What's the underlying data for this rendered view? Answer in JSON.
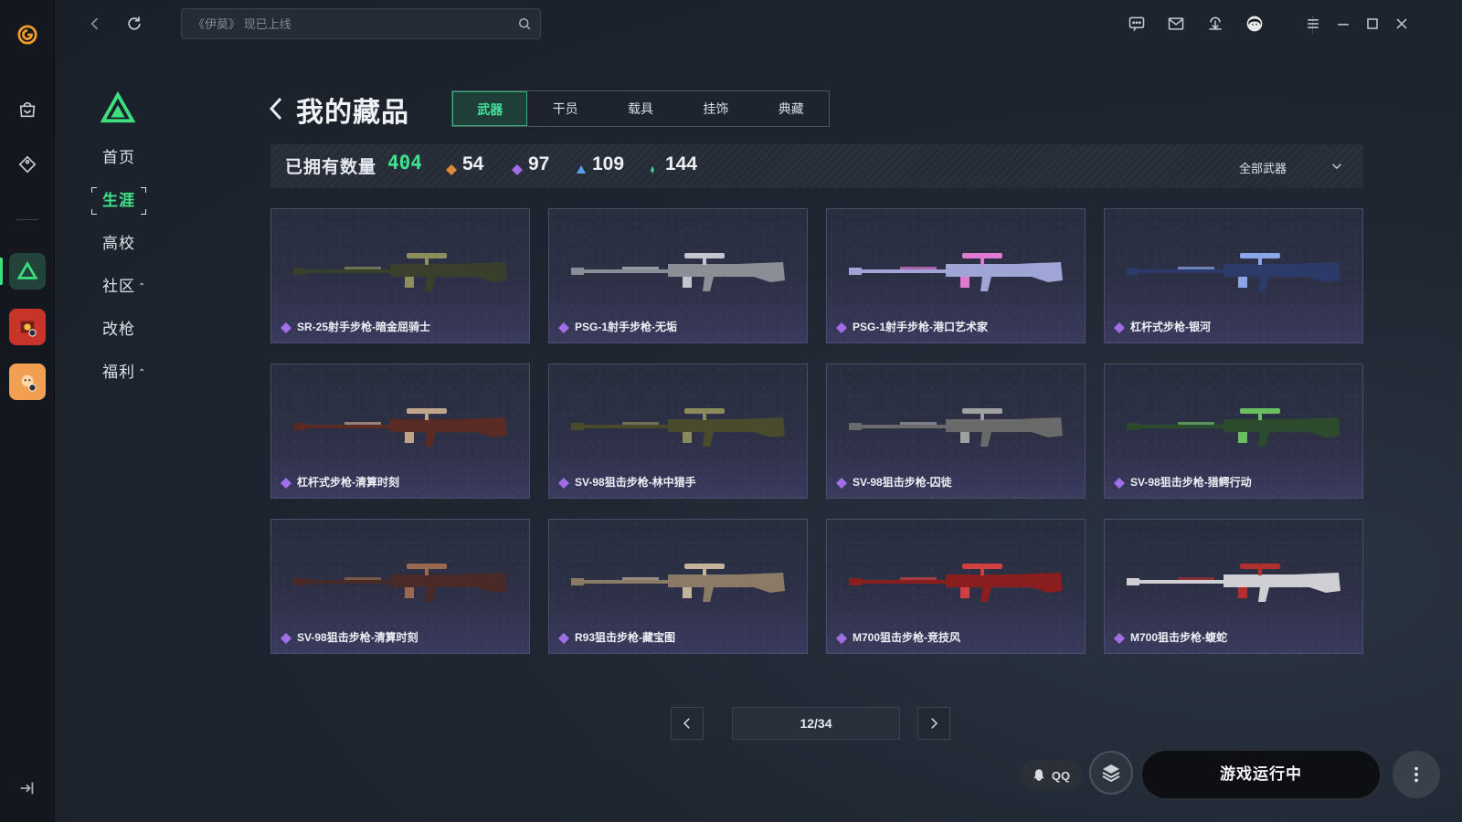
{
  "topbar": {
    "search_placeholder": "《伊莫》 现已上线",
    "qq_label": "QQ"
  },
  "nav": {
    "items": [
      {
        "label": "首页"
      },
      {
        "label": "生涯"
      },
      {
        "label": "高校"
      },
      {
        "label": "社区",
        "caret": "⌃"
      },
      {
        "label": "改枪"
      },
      {
        "label": "福利",
        "caret": "⌃"
      }
    ]
  },
  "header": {
    "title": "我的藏品",
    "tabs": [
      "武器",
      "干员",
      "载具",
      "挂饰",
      "典藏"
    ],
    "active_tab": "武器"
  },
  "stats": {
    "owned_label": "已拥有数量",
    "owned_count": "404",
    "rarities": [
      {
        "count": "54",
        "color": "#e08a3c"
      },
      {
        "count": "97",
        "color": "#a06ee6"
      },
      {
        "count": "109",
        "color": "#5aa0e8"
      },
      {
        "count": "144",
        "color": "#3ed49a"
      }
    ],
    "filter_label": "全部武器"
  },
  "items": [
    {
      "name": "SR-25射手步枪-暗金屈骑士",
      "gun_color": "#3a3f2c",
      "accent": "#8c8f5c"
    },
    {
      "name": "PSG-1射手步枪-无垢",
      "gun_color": "#8a8f96",
      "accent": "#c3c7cc"
    },
    {
      "name": "PSG-1射手步枪-港口艺术家",
      "gun_color": "#9fa6d6",
      "accent": "#e07ad0"
    },
    {
      "name": "杠杆式步枪-银河",
      "gun_color": "#2c3a6a",
      "accent": "#8aa6e8"
    },
    {
      "name": "杠杆式步枪-清算时刻",
      "gun_color": "#5a2a24",
      "accent": "#c0a58a"
    },
    {
      "name": "SV-98狙击步枪-林中猎手",
      "gun_color": "#4a4a2c",
      "accent": "#8a8a5c"
    },
    {
      "name": "SV-98狙击步枪-囚徒",
      "gun_color": "#6a6a6a",
      "accent": "#a0a0a0"
    },
    {
      "name": "SV-98狙击步枪-猎鳄行动",
      "gun_color": "#2c4a2c",
      "accent": "#6ac060"
    },
    {
      "name": "SV-98狙击步枪-清算时刻",
      "gun_color": "#4a2a26",
      "accent": "#9a6a50"
    },
    {
      "name": "R93狙击步枪-藏宝图",
      "gun_color": "#8a7a66",
      "accent": "#c4b49c"
    },
    {
      "name": "M700狙击步枪-竞技风",
      "gun_color": "#8a1e1e",
      "accent": "#d04040"
    },
    {
      "name": "M700狙击步枪-蝮蛇",
      "gun_color": "#d0d0d4",
      "accent": "#b03030"
    }
  ],
  "pager": {
    "display": "12/34"
  },
  "play_button": "游戏运行中"
}
